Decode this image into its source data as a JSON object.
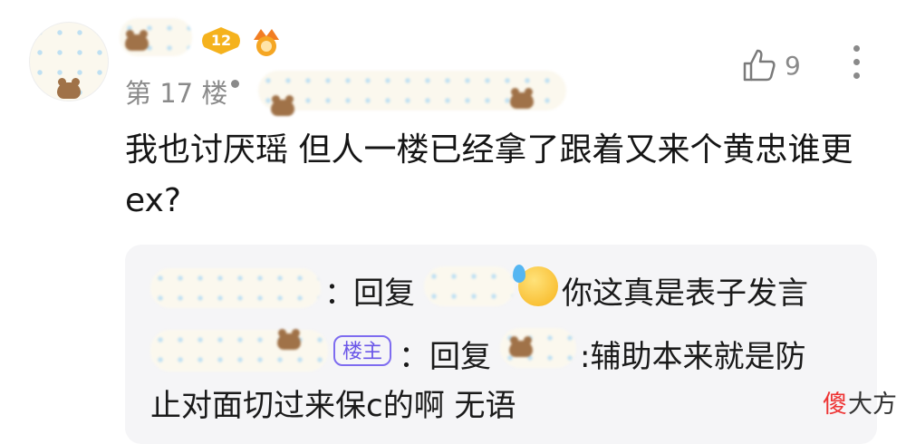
{
  "post": {
    "floor_label": "第 17 楼",
    "separator": "•",
    "level": "12",
    "like_count": "9",
    "content": "我也讨厌瑶 但人一楼已经拿了跟着又来个黄忠谁更 ex?",
    "icons": [
      "avatar",
      "level-badge",
      "medal-icon",
      "like-icon",
      "more-icon"
    ]
  },
  "replies": [
    {
      "colon": "：",
      "reply_word": "回复",
      "emoji": "sweat-face-emoji",
      "text": "你这真是表子发言"
    },
    {
      "op_badge": "楼主",
      "colon": "：",
      "reply_word": "回复",
      "text_line1": ":辅助本来就是防",
      "text_line2": "止对面切过来保c的啊 无语"
    }
  ],
  "watermark": {
    "part1": "傻",
    "part2": "大方"
  },
  "colors": {
    "accent": "#6a56e8",
    "muted": "#8a8a8a",
    "badge_gold": "#f5b21d",
    "watermark_red": "#e33333"
  }
}
